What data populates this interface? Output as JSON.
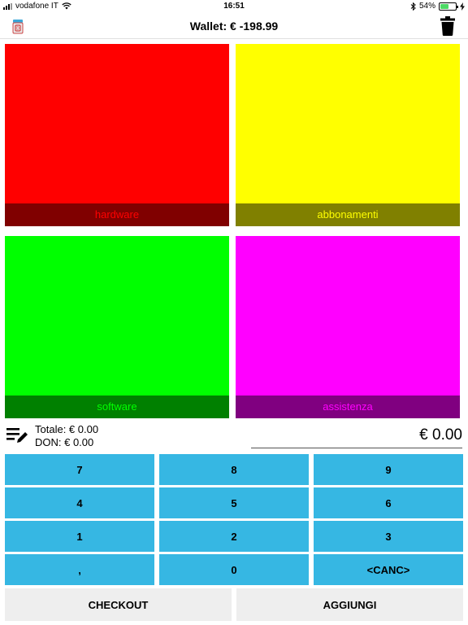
{
  "status_bar": {
    "carrier": "vodafone IT",
    "time": "16:51",
    "battery_percent": "54%",
    "battery_level": 0.54,
    "icons": [
      "signal-icon",
      "wifi-icon",
      "bluetooth-icon",
      "battery-icon",
      "charging-icon"
    ]
  },
  "navbar": {
    "title": "Wallet: € -198.99",
    "left_icon": "app-icon",
    "right_icon": "trash-icon"
  },
  "categories": [
    {
      "label": "hardware",
      "color": "#ff0000",
      "label_bg": "#800000",
      "label_color": "#ff0000"
    },
    {
      "label": "abbonamenti",
      "color": "#ffff00",
      "label_bg": "#808000",
      "label_color": "#ffff00"
    },
    {
      "label": "software",
      "color": "#00ff00",
      "label_bg": "#008000",
      "label_color": "#00ff00"
    },
    {
      "label": "assistenza",
      "color": "#ff00ff",
      "label_bg": "#800080",
      "label_color": "#ff00ff"
    }
  ],
  "summary": {
    "totale": "Totale: € 0.00",
    "don": "DON: € 0.00",
    "amount": "€ 0.00",
    "icon": "edit-list-icon"
  },
  "keypad": {
    "keys": [
      "7",
      "8",
      "9",
      "4",
      "5",
      "6",
      "1",
      "2",
      "3",
      ",",
      "0",
      "<CANC>"
    ],
    "color": "#36b7e3"
  },
  "actions": {
    "checkout": "CHECKOUT",
    "aggiungi": "AGGIUNGI"
  }
}
